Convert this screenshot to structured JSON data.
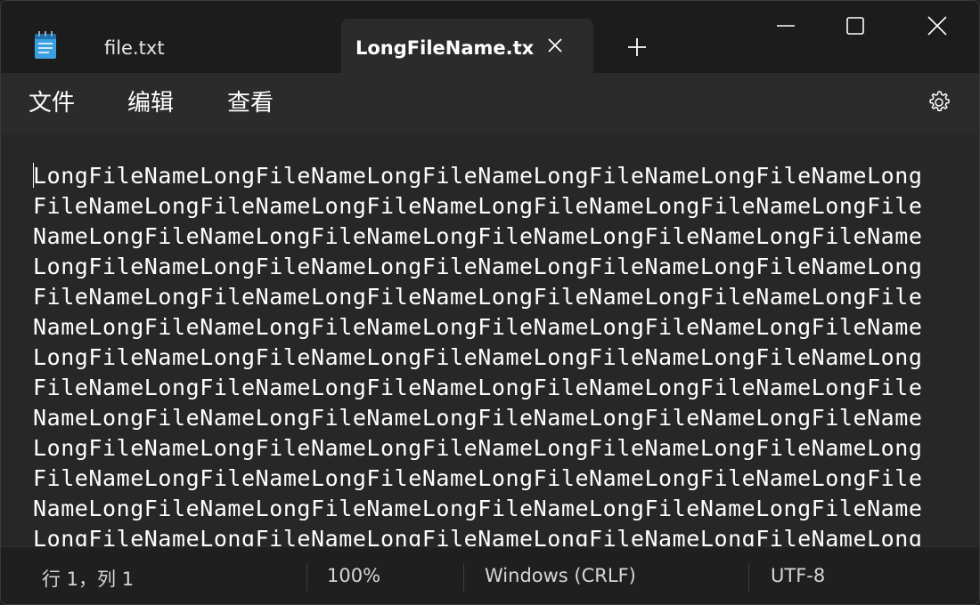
{
  "titlebar": {
    "app_icon": "notepad-icon",
    "tabs": [
      {
        "label": "file.txt",
        "active": false
      },
      {
        "label": "LongFileName.tx",
        "active": true
      }
    ],
    "new_tab_icon": "plus-icon",
    "window_controls": [
      "minimize-icon",
      "maximize-icon",
      "close-icon"
    ]
  },
  "menu": {
    "file": "文件",
    "edit": "编辑",
    "view": "查看",
    "settings_icon": "gear-icon"
  },
  "editor": {
    "lines": [
      "LongFileNameLongFileNameLongFileNameLongFileNameLongFileNameLong",
      "FileNameLongFileNameLongFileNameLongFileNameLongFileNameLongFile",
      "NameLongFileNameLongFileNameLongFileNameLongFileNameLongFileName",
      "LongFileNameLongFileNameLongFileNameLongFileNameLongFileNameLong",
      "FileNameLongFileNameLongFileNameLongFileNameLongFileNameLongFile",
      "NameLongFileNameLongFileNameLongFileNameLongFileNameLongFileName",
      "LongFileNameLongFileNameLongFileNameLongFileNameLongFileNameLong",
      "FileNameLongFileNameLongFileNameLongFileNameLongFileNameLongFile",
      "NameLongFileNameLongFileNameLongFileNameLongFileNameLongFileName",
      "LongFileNameLongFileNameLongFileNameLongFileNameLongFileNameLong",
      "FileNameLongFileNameLongFileNameLongFileNameLongFileNameLongFile",
      "NameLongFileNameLongFileNameLongFileNameLongFileNameLongFileName",
      "LongFileNameLongFileNameLongFileNameLongFileNameLongFileNameLong"
    ]
  },
  "status": {
    "position": "行 1，列 1",
    "zoom": "100%",
    "line_ending": "Windows (CRLF)",
    "encoding": "UTF-8"
  },
  "colors": {
    "titlebar_bg": "#1c1c1c",
    "active_tab_bg": "#2b2b2b",
    "editor_bg": "#272727",
    "statusbar_bg": "#1f1f1f",
    "text": "#ffffff"
  }
}
